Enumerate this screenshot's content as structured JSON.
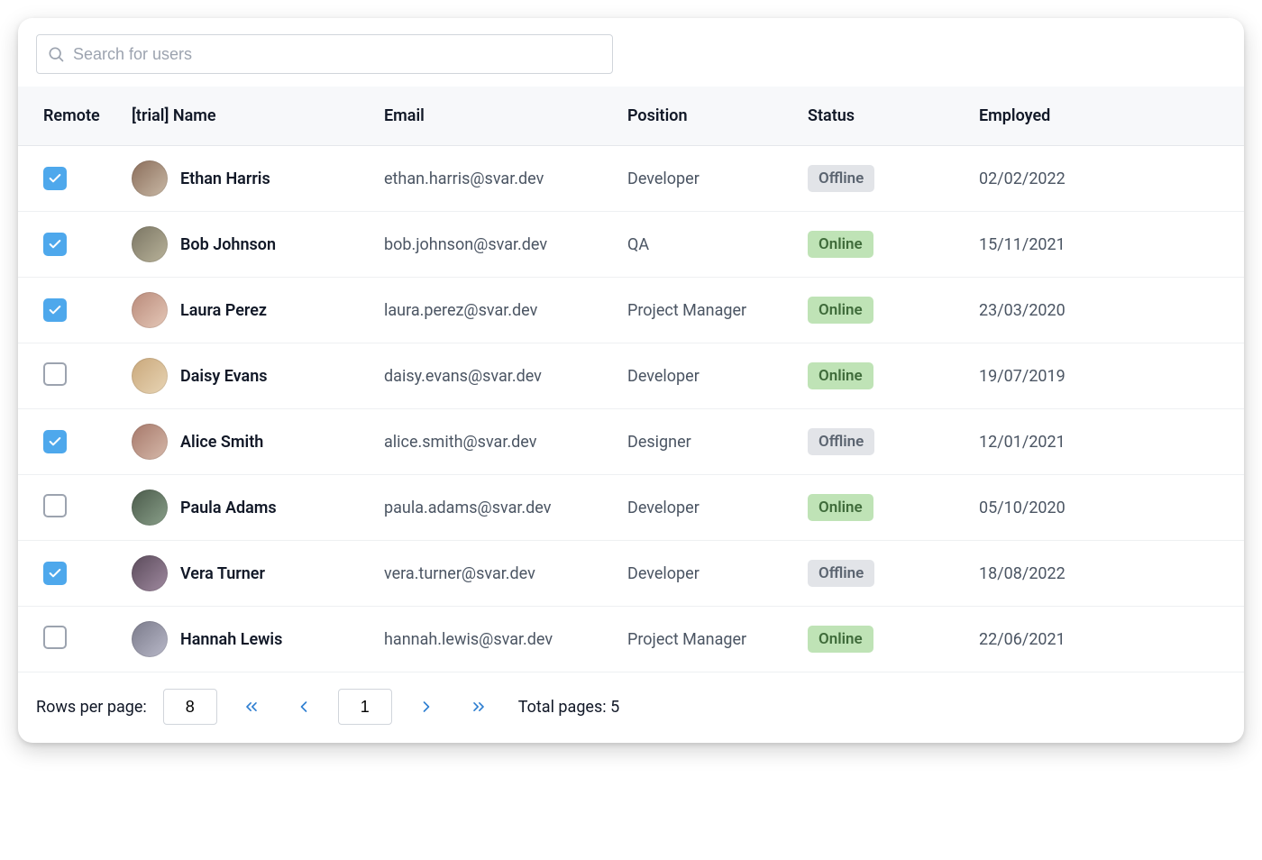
{
  "search": {
    "placeholder": "Search for users",
    "value": ""
  },
  "columns": {
    "remote": "Remote",
    "name": "[trial] Name",
    "email": "Email",
    "position": "Position",
    "status": "Status",
    "employed": "Employed"
  },
  "status_labels": {
    "online": "Online",
    "offline": "Offline"
  },
  "rows": [
    {
      "remote": true,
      "name": "Ethan Harris",
      "email": "ethan.harris@svar.dev",
      "position": "Developer",
      "status": "offline",
      "employed": "02/02/2022"
    },
    {
      "remote": true,
      "name": "Bob Johnson",
      "email": "bob.johnson@svar.dev",
      "position": "QA",
      "status": "online",
      "employed": "15/11/2021"
    },
    {
      "remote": true,
      "name": "Laura Perez",
      "email": "laura.perez@svar.dev",
      "position": "Project Manager",
      "status": "online",
      "employed": "23/03/2020"
    },
    {
      "remote": false,
      "name": "Daisy Evans",
      "email": "daisy.evans@svar.dev",
      "position": "Developer",
      "status": "online",
      "employed": "19/07/2019"
    },
    {
      "remote": true,
      "name": "Alice Smith",
      "email": "alice.smith@svar.dev",
      "position": "Designer",
      "status": "offline",
      "employed": "12/01/2021"
    },
    {
      "remote": false,
      "name": "Paula Adams",
      "email": "paula.adams@svar.dev",
      "position": "Developer",
      "status": "online",
      "employed": "05/10/2020"
    },
    {
      "remote": true,
      "name": "Vera Turner",
      "email": "vera.turner@svar.dev",
      "position": "Developer",
      "status": "offline",
      "employed": "18/08/2022"
    },
    {
      "remote": false,
      "name": "Hannah Lewis",
      "email": "hannah.lewis@svar.dev",
      "position": "Project Manager",
      "status": "online",
      "employed": "22/06/2021"
    }
  ],
  "pager": {
    "rows_per_page_label": "Rows per page:",
    "rows_per_page": "8",
    "current_page": "1",
    "total_pages_label": "Total pages: 5"
  },
  "avatar_gradients": [
    "linear-gradient(135deg,#8a6d5a,#c9b9a6)",
    "linear-gradient(135deg,#7a7563,#b9b39a)",
    "linear-gradient(135deg,#b98a7a,#e5c8b8)",
    "linear-gradient(135deg,#c9a77a,#e8d5b5)",
    "linear-gradient(135deg,#a6786a,#d6b9aa)",
    "linear-gradient(135deg,#4a5a4a,#8aa08a)",
    "linear-gradient(135deg,#5a4a5a,#a08aa0)",
    "linear-gradient(135deg,#7a7a8a,#b9b9c9)"
  ]
}
